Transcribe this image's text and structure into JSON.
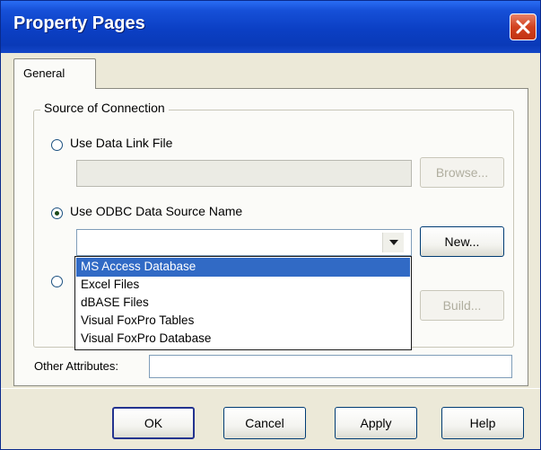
{
  "window": {
    "title": "Property Pages"
  },
  "tabs": [
    {
      "label": "General"
    }
  ],
  "source_group": {
    "label": "Source of Connection",
    "data_link": {
      "label": "Use Data Link File",
      "selected": false,
      "path_value": "",
      "browse_label": "Browse..."
    },
    "odbc": {
      "label": "Use ODBC Data Source Name",
      "selected": true,
      "combo_value": "",
      "new_label": "New..."
    },
    "third_option": {
      "label": "",
      "selected": false,
      "build_label": "Build..."
    }
  },
  "dropdown": {
    "items": [
      {
        "label": "MS Access Database",
        "selected": true
      },
      {
        "label": "Excel Files",
        "selected": false
      },
      {
        "label": "dBASE Files",
        "selected": false
      },
      {
        "label": "Visual FoxPro Tables",
        "selected": false
      },
      {
        "label": "Visual FoxPro Database",
        "selected": false
      }
    ]
  },
  "other_attributes": {
    "label": "Other Attributes:",
    "value": ""
  },
  "buttons": {
    "ok": "OK",
    "cancel": "Cancel",
    "apply": "Apply",
    "help": "Help"
  },
  "colors": {
    "titlebar": "#0a3ab8",
    "selection": "#316ac5",
    "close": "#d2421f",
    "face": "#ece9d8"
  }
}
